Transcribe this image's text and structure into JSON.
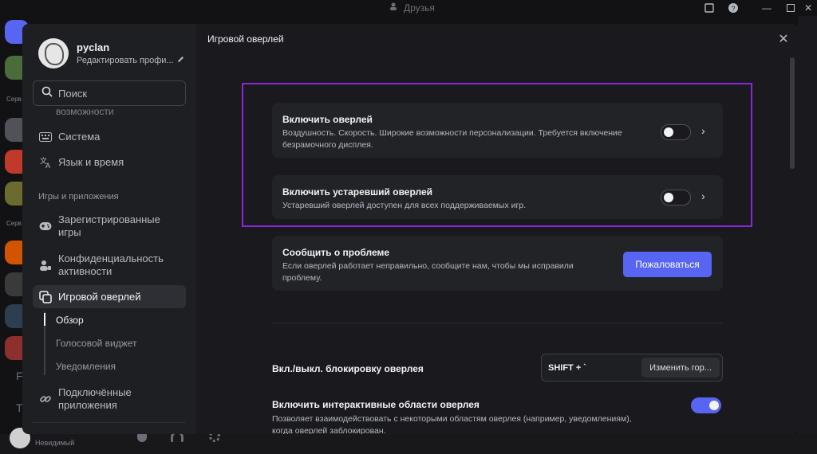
{
  "window": {
    "title": "Друзья"
  },
  "background": {
    "rail_labels": [
      "Серв",
      "Серв"
    ],
    "status": "Невидимый",
    "side_letters": [
      "F",
      "T"
    ]
  },
  "profile": {
    "name": "pyclan",
    "edit_label": "Редактировать профи..."
  },
  "search": {
    "placeholder": "Поиск"
  },
  "sidebar": {
    "clipped_item": "возможности",
    "items_top": [
      {
        "label": "Система",
        "icon": "keyboard-icon"
      },
      {
        "label": "Язык и время",
        "icon": "translate-icon"
      }
    ],
    "section_games": "Игры и приложения",
    "game_items": [
      {
        "label": "Зарегистрированные игры",
        "icon": "gamepad-icon"
      },
      {
        "label": "Конфиденциальность активности",
        "icon": "activity-privacy-icon"
      },
      {
        "label": "Игровой оверлей",
        "icon": "overlay-icon",
        "active": true
      }
    ],
    "sub_items": [
      {
        "label": "Обзор",
        "active": true
      },
      {
        "label": "Голосовой виджет"
      },
      {
        "label": "Уведомления"
      }
    ],
    "connected_apps": {
      "label": "Подключённые приложения",
      "icon": "link-icon"
    }
  },
  "page": {
    "title": "Игровой оверлей"
  },
  "overlay_card": {
    "title": "Включить оверлей",
    "description": "Воздушность. Скорость. Широкие возможности персонализации. Требуется включение безрамочного дисплея.",
    "enabled": false
  },
  "legacy_card": {
    "title": "Включить устаревший оверлей",
    "description": "Устаревший оверлей доступен для всех поддерживаемых игр.",
    "enabled": false
  },
  "report_card": {
    "title": "Сообщить о проблеме",
    "description": "Если оверлей работает неправильно, сообщите нам, чтобы мы исправили проблему.",
    "button": "Пожаловаться"
  },
  "lock_row": {
    "label": "Вкл./выкл. блокировку оверлея",
    "keys": "SHIFT + `",
    "change_button": "Изменить гор..."
  },
  "interactive_row": {
    "label": "Включить интерактивные области оверлея",
    "description": "Позволяет взаимодействовать с некоторыми областям оверлея (например, уведомлениям), когда оверлей заблокирован.",
    "enabled": true
  },
  "colors": {
    "accent": "#5865f2",
    "highlight": "#8a25d8",
    "bg": "#1a1a1e",
    "card": "#222327"
  }
}
